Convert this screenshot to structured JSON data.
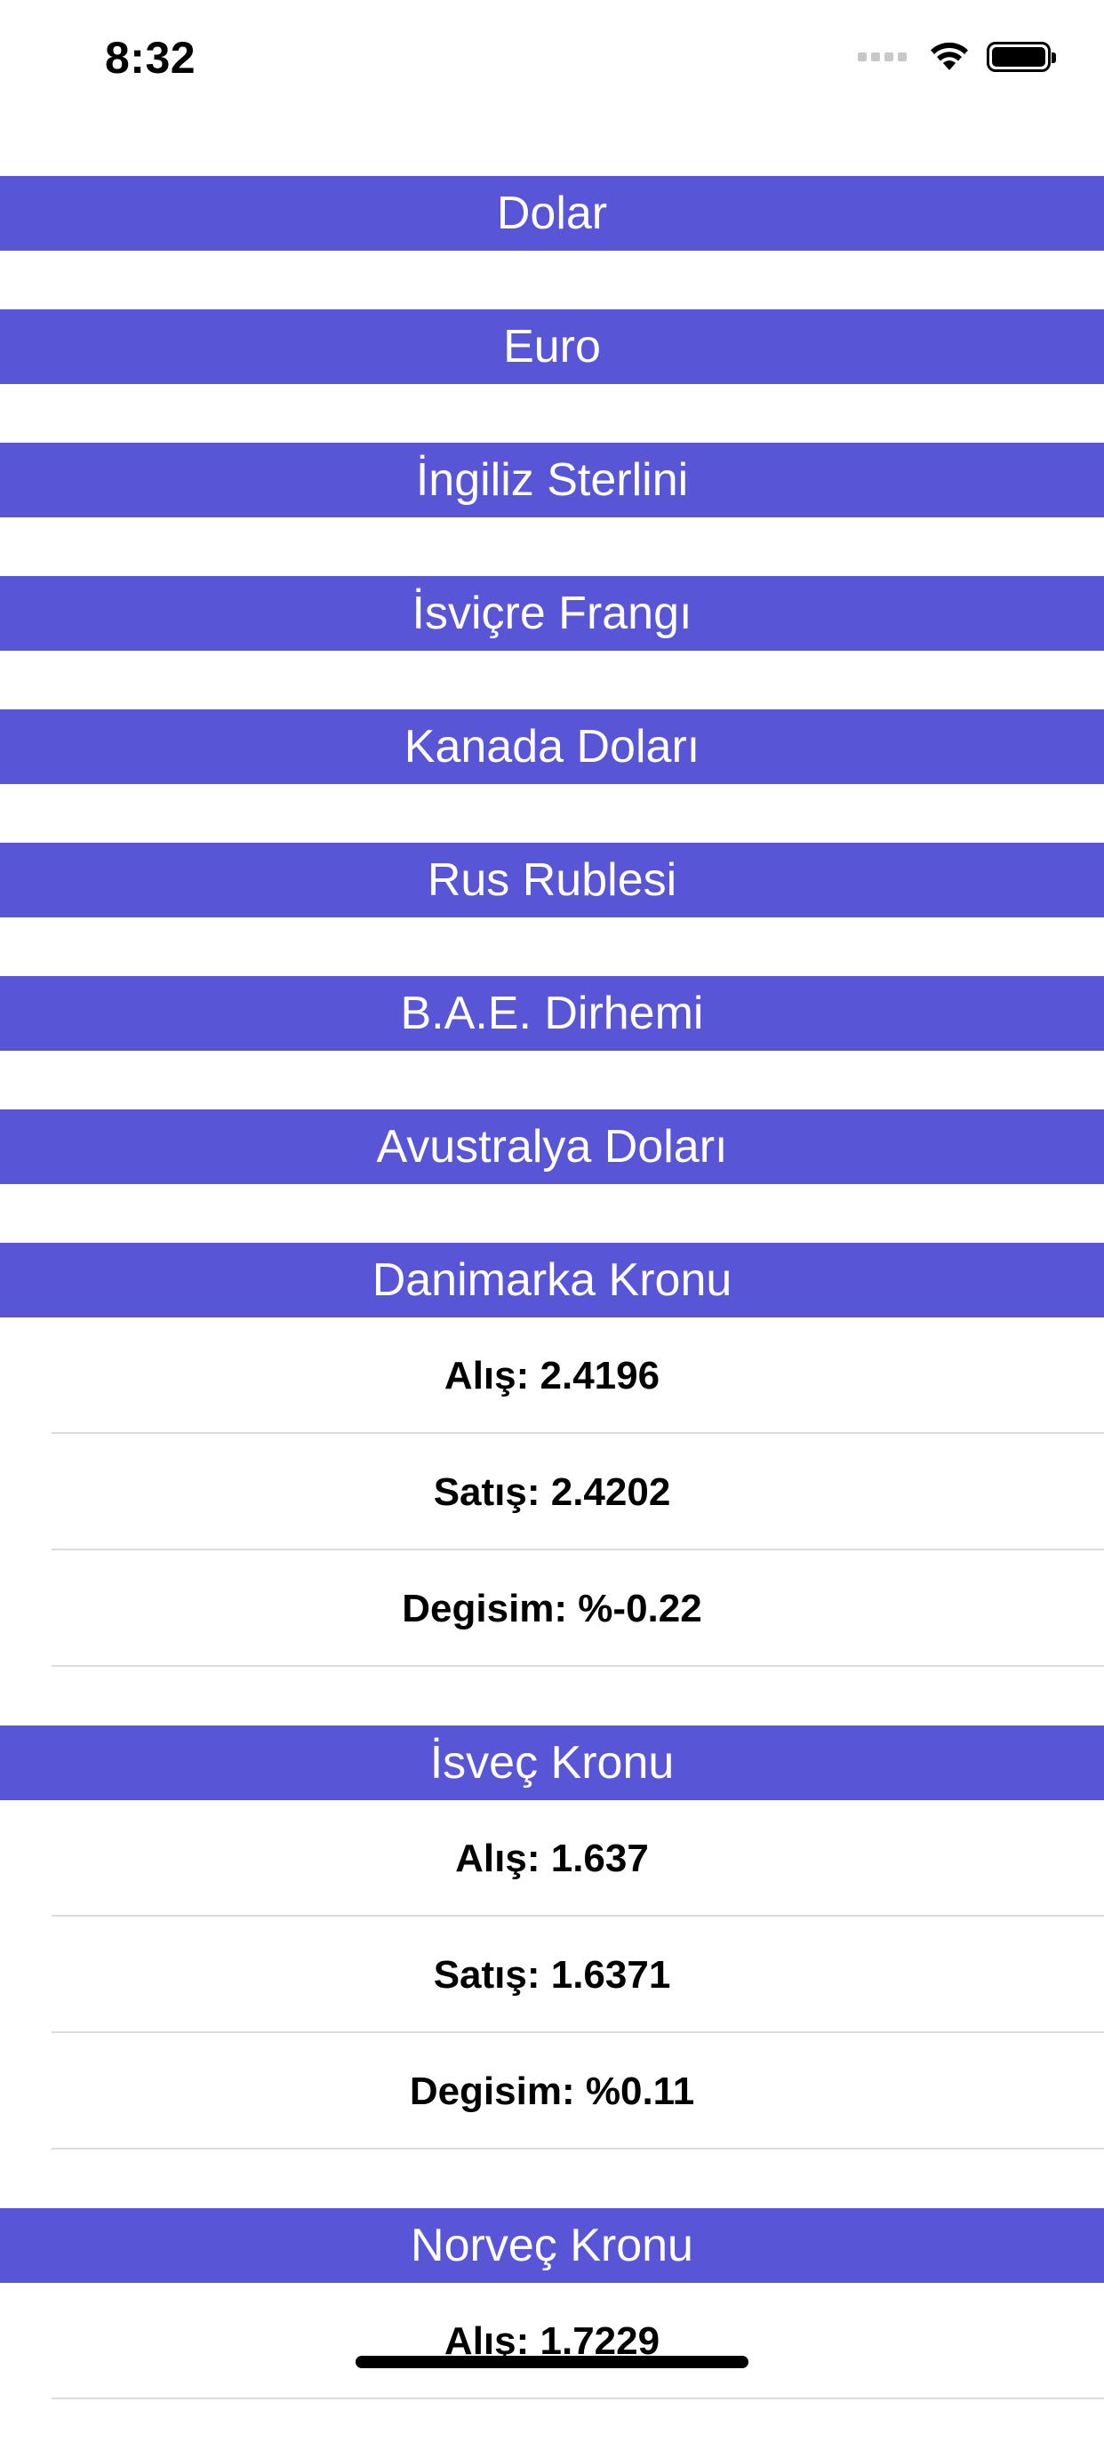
{
  "status_bar": {
    "time": "8:32"
  },
  "colors": {
    "header_bg": "#5856d6",
    "header_text": "#ffffff",
    "row_text": "#000000",
    "separator": "#dcdce0"
  },
  "icons": {
    "signal": "cellular-signal-icon",
    "wifi": "wifi-icon",
    "battery": "battery-icon"
  },
  "currencies": [
    {
      "name": "Dolar"
    },
    {
      "name": "Euro"
    },
    {
      "name": "İngiliz Sterlini"
    },
    {
      "name": "İsviçre Frangı"
    },
    {
      "name": "Kanada Doları"
    },
    {
      "name": "Rus Rublesi"
    },
    {
      "name": "B.A.E. Dirhemi"
    },
    {
      "name": "Avustralya Doları"
    },
    {
      "name": "Danimarka Kronu",
      "rows": [
        "Alış: 2.4196",
        "Satış: 2.4202",
        "Degisim: %-0.22"
      ]
    },
    {
      "name": "İsveç Kronu",
      "rows": [
        "Alış: 1.637",
        "Satış: 1.6371",
        "Degisim: %0.11"
      ]
    },
    {
      "name": "Norveç Kronu",
      "rows": [
        "Alış: 1.7229"
      ]
    }
  ]
}
